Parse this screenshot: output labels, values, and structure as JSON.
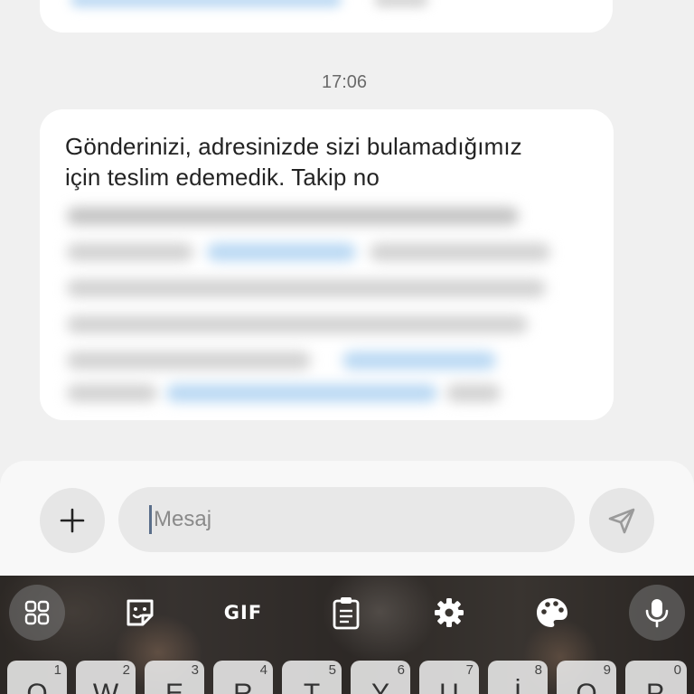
{
  "conversation": {
    "timestamp": "17:06",
    "message": {
      "line1": "Gönderinizi, adresinizde sizi bulamadığımız",
      "line2": "için teslim edemedik. Takip no"
    }
  },
  "composer": {
    "placeholder": "Mesaj"
  },
  "keyboard": {
    "toolbar": {
      "gif_label": "GIF"
    },
    "top_row": [
      {
        "char": "Q",
        "num": "1"
      },
      {
        "char": "W",
        "num": "2"
      },
      {
        "char": "E",
        "num": "3"
      },
      {
        "char": "R",
        "num": "4"
      },
      {
        "char": "T",
        "num": "5"
      },
      {
        "char": "Y",
        "num": "6"
      },
      {
        "char": "U",
        "num": "7"
      },
      {
        "char": "İ",
        "num": "8"
      },
      {
        "char": "O",
        "num": "9"
      },
      {
        "char": "P",
        "num": "0"
      }
    ]
  },
  "colors": {
    "background": "#f0f0f0",
    "bubble": "#ffffff",
    "link_blur": "#b9d8f3",
    "keyboard_key": "#ebebeb"
  }
}
